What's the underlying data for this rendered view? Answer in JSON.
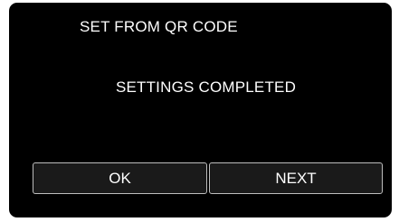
{
  "screen": {
    "title": "SET FROM QR CODE",
    "message": "SETTINGS COMPLETED"
  },
  "buttons": {
    "ok_label": "OK",
    "next_label": "NEXT"
  },
  "colors": {
    "background": "#000000",
    "text": "#ffffff",
    "button_border": "#bdbdbd",
    "button_fill": "#1a1a1a"
  }
}
